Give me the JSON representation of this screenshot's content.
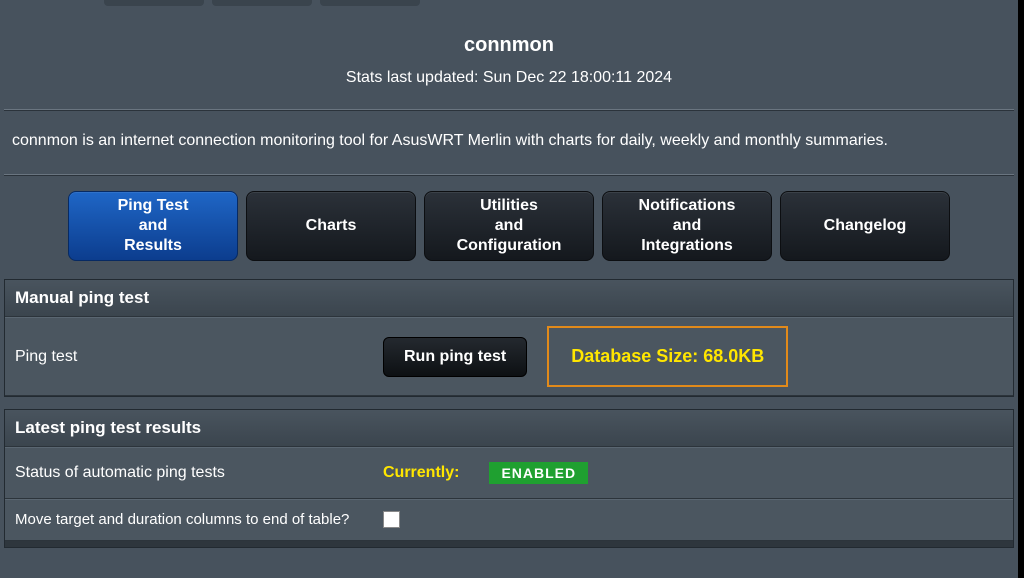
{
  "header": {
    "title": "connmon",
    "stats_line": "Stats last updated: Sun Dec 22 18:00:11 2024",
    "description": "connmon is an internet connection monitoring tool for AsusWRT Merlin with charts for daily, weekly and monthly summaries."
  },
  "tabs": [
    {
      "label": "Ping Test\nand\nResults",
      "active": true
    },
    {
      "label": "Charts",
      "active": false
    },
    {
      "label": "Utilities\nand\nConfiguration",
      "active": false
    },
    {
      "label": "Notifications\nand\nIntegrations",
      "active": false
    },
    {
      "label": "Changelog",
      "active": false
    }
  ],
  "manual_ping": {
    "panel_title": "Manual ping test",
    "row_label": "Ping test",
    "run_button": "Run ping test",
    "db_size_label": "Database Size: 68.0KB"
  },
  "latest_results": {
    "panel_title": "Latest ping test results",
    "status_row_label": "Status of automatic ping tests",
    "currently_label": "Currently:",
    "status_value": "ENABLED",
    "move_cols_label": "Move target and duration columns to end of table?",
    "move_cols_checked": false
  }
}
